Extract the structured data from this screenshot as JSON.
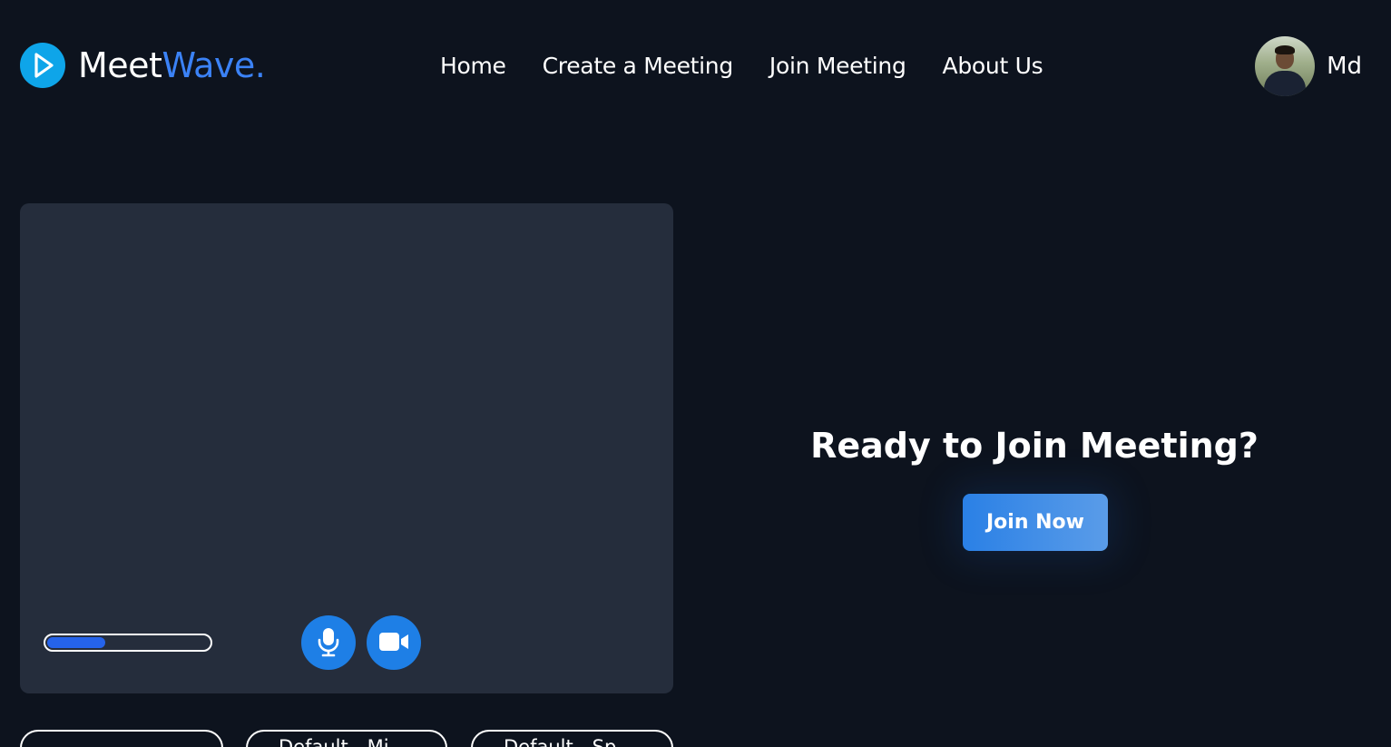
{
  "brand": {
    "name_part1": "Meet",
    "name_part2": "Wave.",
    "icon": "play-icon",
    "colors": {
      "icon_bg": "#0ea5e9",
      "accent": "#3b82f6"
    }
  },
  "nav": {
    "items": [
      {
        "label": "Home"
      },
      {
        "label": "Create a Meeting"
      },
      {
        "label": "Join Meeting"
      },
      {
        "label": "About Us"
      }
    ]
  },
  "user": {
    "name": "Md"
  },
  "preview": {
    "mic_level": 0.36,
    "mic_icon": "microphone-icon",
    "camera_icon": "video-camera-icon",
    "colors": {
      "panel_bg": "#252d3c",
      "control": "#1e7fe6",
      "meter": "#2563eb"
    }
  },
  "join": {
    "title": "Ready to Join Meeting?",
    "button_label": "Join Now"
  },
  "devices": {
    "camera_select": {
      "value": ""
    },
    "microphone_select": {
      "value": "Default - Mi"
    },
    "speaker_select": {
      "value": "Default - Sp"
    }
  },
  "colors": {
    "page_bg": "#0d131e",
    "text": "#ffffff"
  }
}
